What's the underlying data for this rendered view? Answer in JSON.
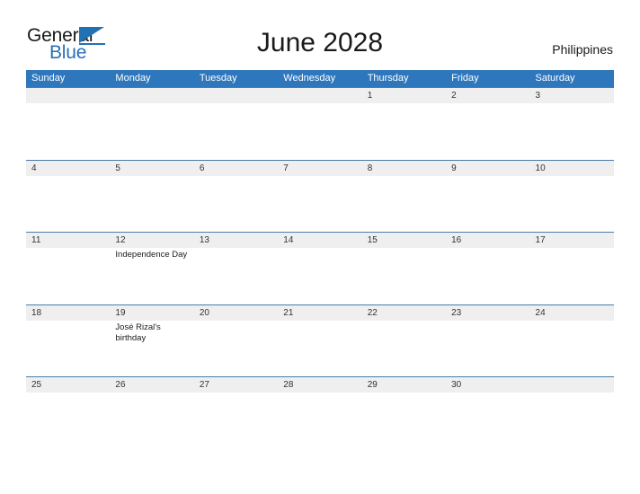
{
  "brand": {
    "name_part1": "General",
    "name_part2": "Blue",
    "triangle_icon": "triangle-icon",
    "accent_color": "#2171b5"
  },
  "header": {
    "title": "June 2028",
    "country": "Philippines"
  },
  "colors": {
    "weekday_header_bg": "#2f77bc",
    "weekday_header_text": "#ffffff",
    "date_band_bg": "#efefef",
    "row_divider": "#4a7ca8",
    "page_bg": "#ffffff",
    "text": "#1a1a1a"
  },
  "calendar": {
    "month": "June",
    "year": "2028",
    "weekdays": [
      "Sunday",
      "Monday",
      "Tuesday",
      "Wednesday",
      "Thursday",
      "Friday",
      "Saturday"
    ],
    "weeks": [
      [
        {
          "date": "",
          "event": ""
        },
        {
          "date": "",
          "event": ""
        },
        {
          "date": "",
          "event": ""
        },
        {
          "date": "",
          "event": ""
        },
        {
          "date": "1",
          "event": ""
        },
        {
          "date": "2",
          "event": ""
        },
        {
          "date": "3",
          "event": ""
        }
      ],
      [
        {
          "date": "4",
          "event": ""
        },
        {
          "date": "5",
          "event": ""
        },
        {
          "date": "6",
          "event": ""
        },
        {
          "date": "7",
          "event": ""
        },
        {
          "date": "8",
          "event": ""
        },
        {
          "date": "9",
          "event": ""
        },
        {
          "date": "10",
          "event": ""
        }
      ],
      [
        {
          "date": "11",
          "event": ""
        },
        {
          "date": "12",
          "event": "Independence Day"
        },
        {
          "date": "13",
          "event": ""
        },
        {
          "date": "14",
          "event": ""
        },
        {
          "date": "15",
          "event": ""
        },
        {
          "date": "16",
          "event": ""
        },
        {
          "date": "17",
          "event": ""
        }
      ],
      [
        {
          "date": "18",
          "event": ""
        },
        {
          "date": "19",
          "event": "José Rizal's birthday"
        },
        {
          "date": "20",
          "event": ""
        },
        {
          "date": "21",
          "event": ""
        },
        {
          "date": "22",
          "event": ""
        },
        {
          "date": "23",
          "event": ""
        },
        {
          "date": "24",
          "event": ""
        }
      ],
      [
        {
          "date": "25",
          "event": ""
        },
        {
          "date": "26",
          "event": ""
        },
        {
          "date": "27",
          "event": ""
        },
        {
          "date": "28",
          "event": ""
        },
        {
          "date": "29",
          "event": ""
        },
        {
          "date": "30",
          "event": ""
        },
        {
          "date": "",
          "event": ""
        }
      ]
    ]
  }
}
